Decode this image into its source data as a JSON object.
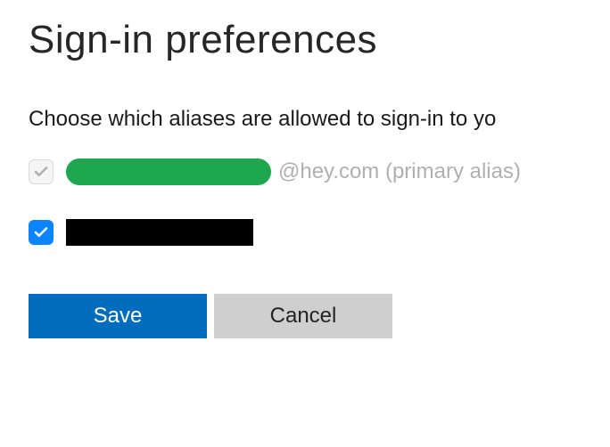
{
  "title": "Sign-in preferences",
  "instruction": "Choose which aliases are allowed to sign-in to yo",
  "aliases": [
    {
      "checked": true,
      "disabled": true,
      "text_suffix": "@hey.com (primary alias)"
    },
    {
      "checked": true,
      "disabled": false,
      "text_suffix": ""
    }
  ],
  "buttons": {
    "save": "Save",
    "cancel": "Cancel"
  },
  "colors": {
    "accent_blue": "#0a84ff",
    "save_blue": "#006cbe",
    "redact_green": "#1fa74f"
  }
}
